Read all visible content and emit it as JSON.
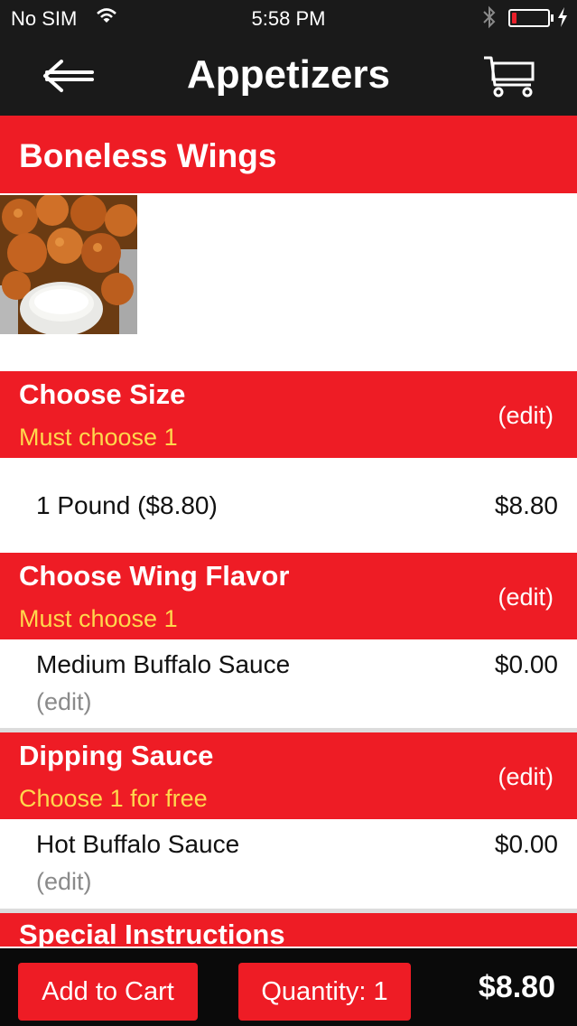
{
  "status_bar": {
    "carrier": "No SIM",
    "time": "5:58 PM",
    "battery_level": 0.12,
    "battery_color": "#e8202a"
  },
  "nav": {
    "title": "Appetizers",
    "back_icon": "back-arrow-icon",
    "cart_icon": "cart-icon"
  },
  "item": {
    "title": "Boneless Wings",
    "image_alt": "boneless wings photo"
  },
  "sections": [
    {
      "title": "Choose Size",
      "requirement": "Must choose 1",
      "edit_label": "(edit)",
      "selection": {
        "name": "1 Pound ($8.80)",
        "price": "$8.80"
      }
    },
    {
      "title": "Choose Wing Flavor",
      "requirement": "Must choose 1",
      "edit_label": "(edit)",
      "selection": {
        "name": "Medium Buffalo Sauce",
        "price": "$0.00",
        "edit_label": "(edit)"
      }
    },
    {
      "title": "Dipping Sauce",
      "requirement": "Choose 1 for free",
      "edit_label": "(edit)",
      "selection": {
        "name": "Hot Buffalo Sauce",
        "price": "$0.00",
        "edit_label": "(edit)"
      }
    },
    {
      "title": "Special Instructions"
    }
  ],
  "footer": {
    "add_to_cart_label": "Add to Cart",
    "quantity_label": "Quantity: 1",
    "total": "$8.80"
  },
  "colors": {
    "accent_red": "#ee1c25",
    "requirement_yellow": "#ffd84d",
    "bar_black": "#1a1a1a"
  }
}
